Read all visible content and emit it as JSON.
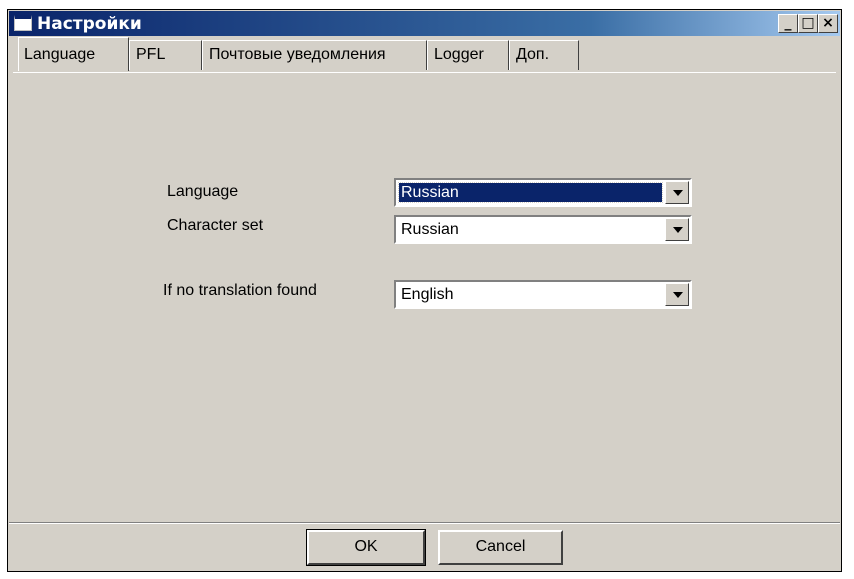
{
  "window": {
    "title": "Настройки",
    "controls": {
      "minimize": "_",
      "maximize": "□",
      "close": "×"
    }
  },
  "tabs": [
    {
      "label": "Language",
      "active": true
    },
    {
      "label": "PFL",
      "active": false
    },
    {
      "label": "Почтовые уведомления",
      "active": false
    },
    {
      "label": "Logger",
      "active": false
    },
    {
      "label": "Доп.",
      "active": false
    }
  ],
  "language_tab": {
    "language_label": "Language",
    "language_value": "Russian",
    "charset_label": "Character set",
    "charset_value": "Russian",
    "fallback_label": "If no translation found",
    "fallback_value": "English"
  },
  "buttons": {
    "ok": "OK",
    "cancel": "Cancel"
  },
  "colors": {
    "titlebar": "#0a246a",
    "face": "#d4d0c8",
    "selection": "#0a246a"
  }
}
